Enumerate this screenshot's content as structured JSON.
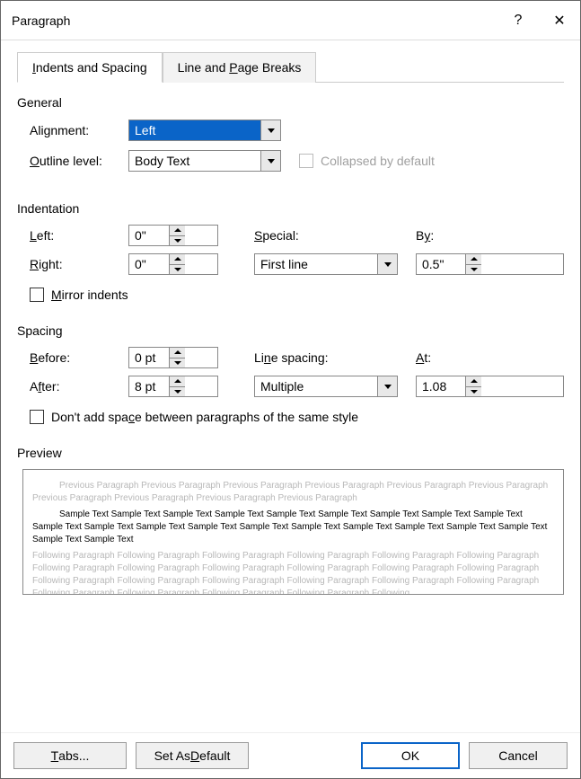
{
  "title": "Paragraph",
  "help": "?",
  "close": "✕",
  "tabs": {
    "indents": "Indents and Spacing",
    "linebreaks": "Line and Page Breaks"
  },
  "general": {
    "legend": "General",
    "alignment_label": "Alignment:",
    "alignment_value": "Left",
    "outline_label": "Outline level:",
    "outline_value": "Body Text",
    "collapsed_label": "Collapsed by default"
  },
  "indentation": {
    "legend": "Indentation",
    "left_label": "Left:",
    "left_value": "0\"",
    "right_label": "Right:",
    "right_value": "0\"",
    "special_label": "Special:",
    "special_value": "First line",
    "by_label": "By:",
    "by_value": "0.5\"",
    "mirror_label": "Mirror indents"
  },
  "spacing": {
    "legend": "Spacing",
    "before_label": "Before:",
    "before_value": "0 pt",
    "after_label": "After:",
    "after_value": "8 pt",
    "line_label": "Line spacing:",
    "line_value": "Multiple",
    "at_label": "At:",
    "at_value": "1.08",
    "dontadd_label": "Don't add space between paragraphs of the same style"
  },
  "preview": {
    "legend": "Preview",
    "prev": "Previous Paragraph Previous Paragraph Previous Paragraph Previous Paragraph Previous Paragraph Previous Paragraph Previous Paragraph Previous Paragraph Previous Paragraph Previous Paragraph",
    "sample": "Sample Text Sample Text Sample Text Sample Text Sample Text Sample Text Sample Text Sample Text Sample Text Sample Text Sample Text Sample Text Sample Text Sample Text Sample Text Sample Text Sample Text Sample Text Sample Text Sample Text Sample Text",
    "next": "Following Paragraph Following Paragraph Following Paragraph Following Paragraph Following Paragraph Following Paragraph Following Paragraph Following Paragraph Following Paragraph Following Paragraph Following Paragraph Following Paragraph Following Paragraph Following Paragraph Following Paragraph Following Paragraph Following Paragraph Following Paragraph Following Paragraph Following Paragraph Following Paragraph Following Paragraph Following"
  },
  "buttons": {
    "tabs": "Tabs...",
    "default": "Set As Default",
    "ok": "OK",
    "cancel": "Cancel"
  }
}
